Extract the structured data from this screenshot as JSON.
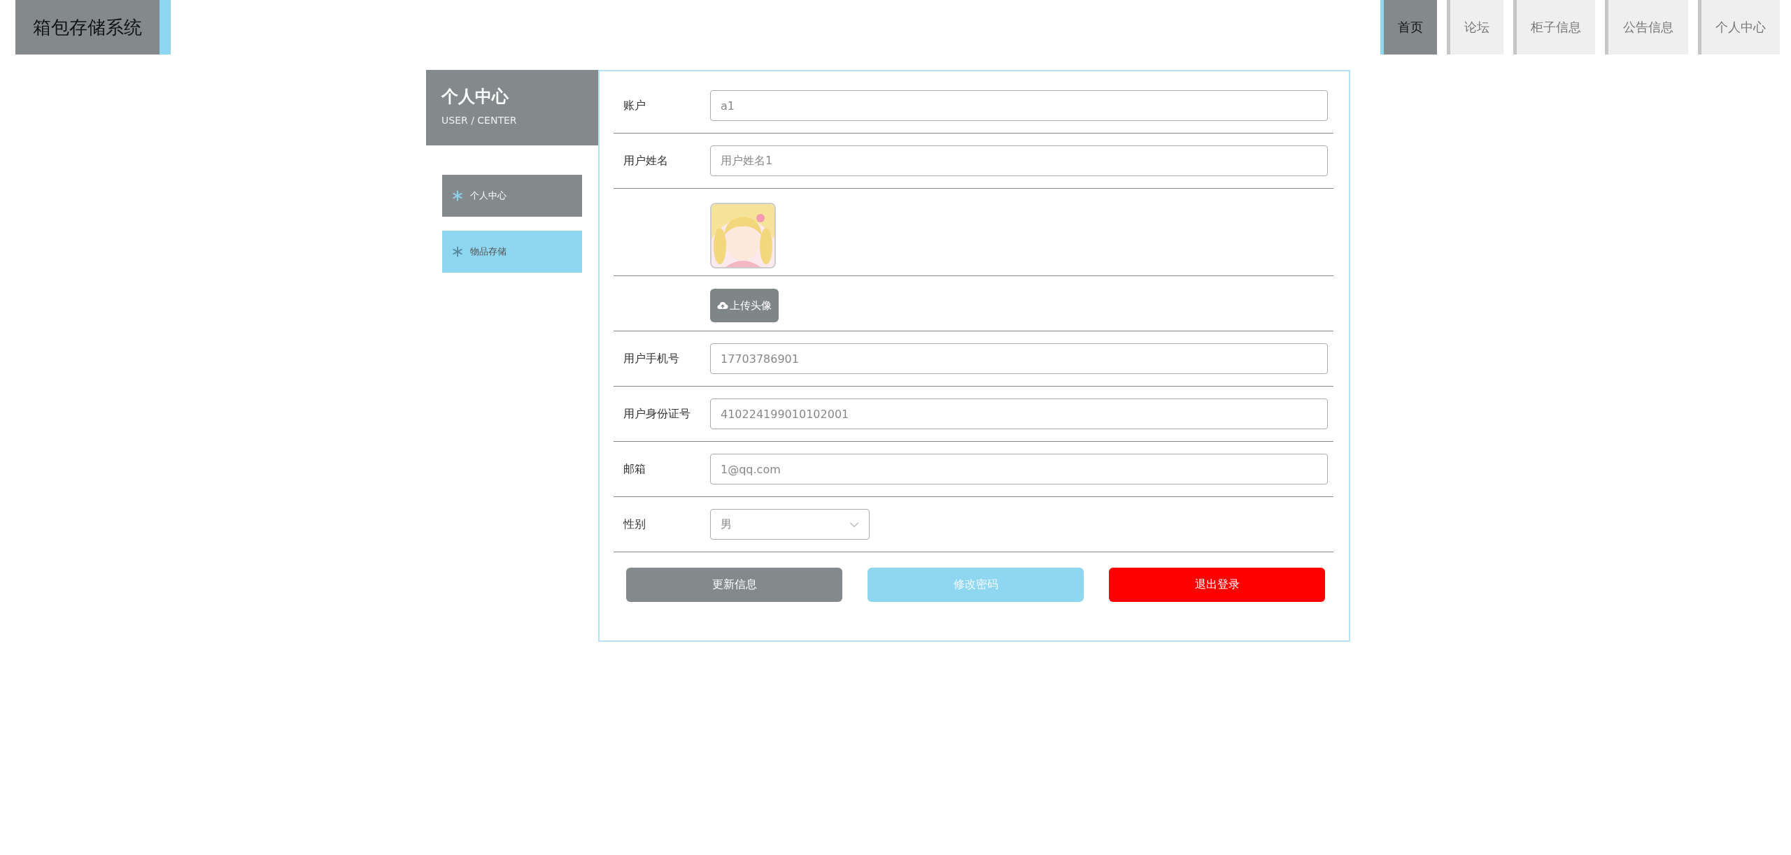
{
  "header": {
    "title": "箱包存储系统"
  },
  "nav": [
    {
      "label": "首页",
      "selected": true
    },
    {
      "label": "论坛",
      "selected": false
    },
    {
      "label": "柜子信息",
      "selected": false
    },
    {
      "label": "公告信息",
      "selected": false
    },
    {
      "label": "个人中心",
      "selected": false
    }
  ],
  "sidebar": {
    "title": "个人中心",
    "subtitle": "USER / CENTER",
    "items": [
      {
        "label": "个人中心",
        "selected": true
      },
      {
        "label": "物品存储",
        "selected": false
      }
    ]
  },
  "form": {
    "fields": [
      {
        "kind": "text",
        "label": "账户",
        "value": "a1"
      },
      {
        "kind": "text",
        "label": "用户姓名",
        "value": "用户姓名1"
      },
      {
        "kind": "avatar"
      },
      {
        "kind": "upload",
        "button": "上传头像"
      },
      {
        "kind": "text",
        "label": "用户手机号",
        "value": "17703786901"
      },
      {
        "kind": "text",
        "label": "用户身份证号",
        "value": "410224199010102001"
      },
      {
        "kind": "text",
        "label": "邮箱",
        "value": "1@qq.com"
      },
      {
        "kind": "select",
        "label": "性别",
        "value": "男"
      }
    ],
    "buttons": [
      {
        "kind": "update",
        "label": "更新信息"
      },
      {
        "kind": "password",
        "label": "修改密码"
      },
      {
        "kind": "logout",
        "label": "退出登录"
      }
    ]
  }
}
